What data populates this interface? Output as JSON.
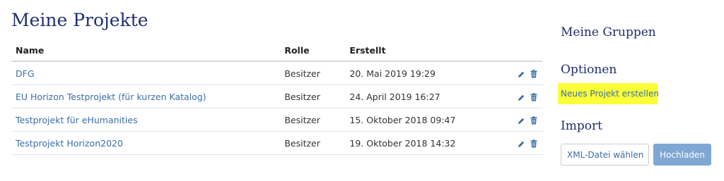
{
  "main": {
    "title": "Meine Projekte",
    "columns": [
      "Name",
      "Rolle",
      "Erstellt"
    ],
    "rows": [
      {
        "name": "DFG",
        "role": "Besitzer",
        "created": "20. Mai 2019 19:29"
      },
      {
        "name": "EU Horizon Testprojekt (für kurzen Katalog)",
        "role": "Besitzer",
        "created": "24. April 2019 16:27"
      },
      {
        "name": "Testprojekt für eHumanities",
        "role": "Besitzer",
        "created": "15. Oktober 2018 09:47"
      },
      {
        "name": "Testprojekt Horizon2020",
        "role": "Besitzer",
        "created": "19. Oktober 2018 14:32"
      }
    ]
  },
  "sidebar": {
    "groups_heading": "Meine Gruppen",
    "options_heading": "Optionen",
    "new_project_label": "Neues Projekt erstellen",
    "import_heading": "Import",
    "file_button_label": "XML-Datei wählen",
    "upload_button_label": "Hochladen"
  },
  "colors": {
    "heading": "#1f2f6e",
    "link": "#3b6ea8",
    "highlight": "#fbff3a",
    "upload_button": "#7fa7d3"
  },
  "icons": [
    "pencil-icon",
    "trash-icon"
  ]
}
